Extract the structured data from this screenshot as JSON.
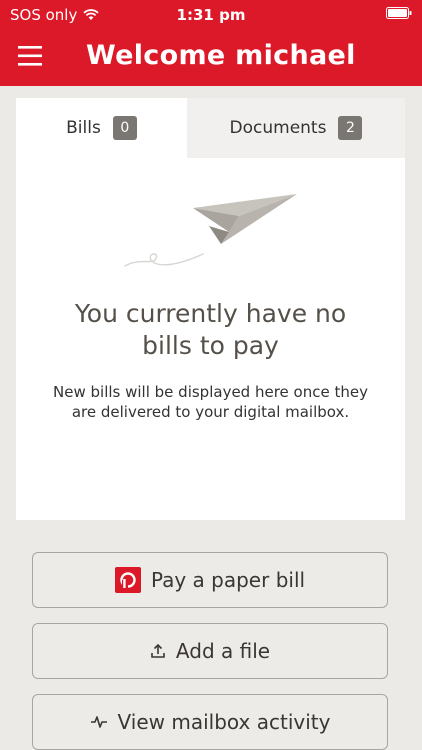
{
  "status_bar": {
    "carrier": "SOS only",
    "time": "1:31 pm"
  },
  "header": {
    "title": "Welcome michael",
    "menu_icon": "hamburger-icon"
  },
  "tabs": [
    {
      "label": "Bills",
      "count": "0",
      "active": true
    },
    {
      "label": "Documents",
      "count": "2",
      "active": false
    }
  ],
  "empty_state": {
    "title": "You currently have no bills to pay",
    "description": "New bills will be displayed here once they are delivered to your digital mailbox.",
    "icon": "paper-plane-icon"
  },
  "actions": {
    "pay_paper_bill": "Pay a paper bill",
    "add_file": "Add a file",
    "view_activity": "View mailbox activity"
  },
  "colors": {
    "brand_red": "#DC1928",
    "background": "#ECEAE6",
    "badge": "#7A7773"
  }
}
